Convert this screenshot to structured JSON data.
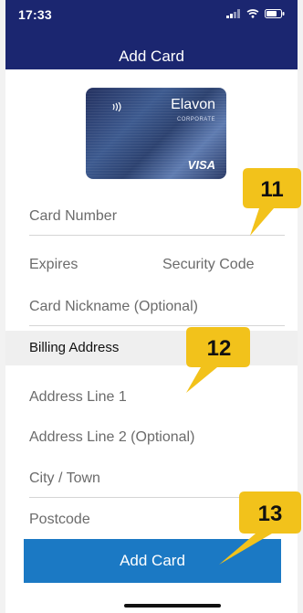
{
  "status_bar": {
    "time": "17:33"
  },
  "nav": {
    "title": "Add Card"
  },
  "card_image": {
    "brand": "Elavon",
    "subtitle": "CORPORATE",
    "network": "VISA"
  },
  "form": {
    "card_number": "Card Number",
    "expires": "Expires",
    "security_code": "Security Code",
    "nickname": "Card Nickname (Optional)",
    "billing_section": "Billing Address",
    "address1": "Address Line 1",
    "address2": "Address Line 2 (Optional)",
    "city": "City / Town",
    "postcode": "Postcode"
  },
  "submit_button": {
    "label": "Add Card"
  },
  "callouts": [
    "11",
    "12",
    "13"
  ],
  "colors": {
    "header": "#1b2670",
    "button": "#1b79c4",
    "callout": "#f2c21b"
  }
}
